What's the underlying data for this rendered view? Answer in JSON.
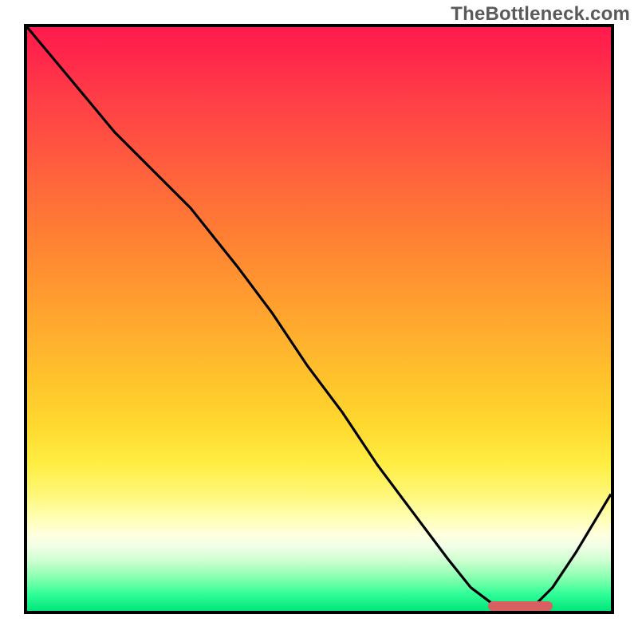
{
  "watermark": "TheBottleneck.com",
  "colors": {
    "frame": "#000000",
    "curve": "#000000",
    "marker": "#d96060",
    "gradient_top": "#ff1a4d",
    "gradient_bottom": "#00e67a"
  },
  "chart_data": {
    "type": "line",
    "title": "",
    "xlabel": "",
    "ylabel": "",
    "xlim": [
      0,
      100
    ],
    "ylim": [
      0,
      100
    ],
    "grid": false,
    "series": [
      {
        "name": "bottleneck-curve",
        "x": [
          0,
          5,
          10,
          15,
          20,
          24,
          28,
          32,
          36,
          42,
          48,
          54,
          60,
          66,
          72,
          76,
          80,
          82,
          86,
          90,
          94,
          100
        ],
        "y": [
          100,
          94,
          88,
          82,
          77,
          73,
          69,
          64,
          59,
          51,
          42,
          34,
          25,
          17,
          9,
          4,
          1,
          0,
          0,
          4,
          10,
          20
        ]
      }
    ],
    "marker_band": {
      "x_start": 79,
      "x_end": 90,
      "y": 0.8
    }
  }
}
